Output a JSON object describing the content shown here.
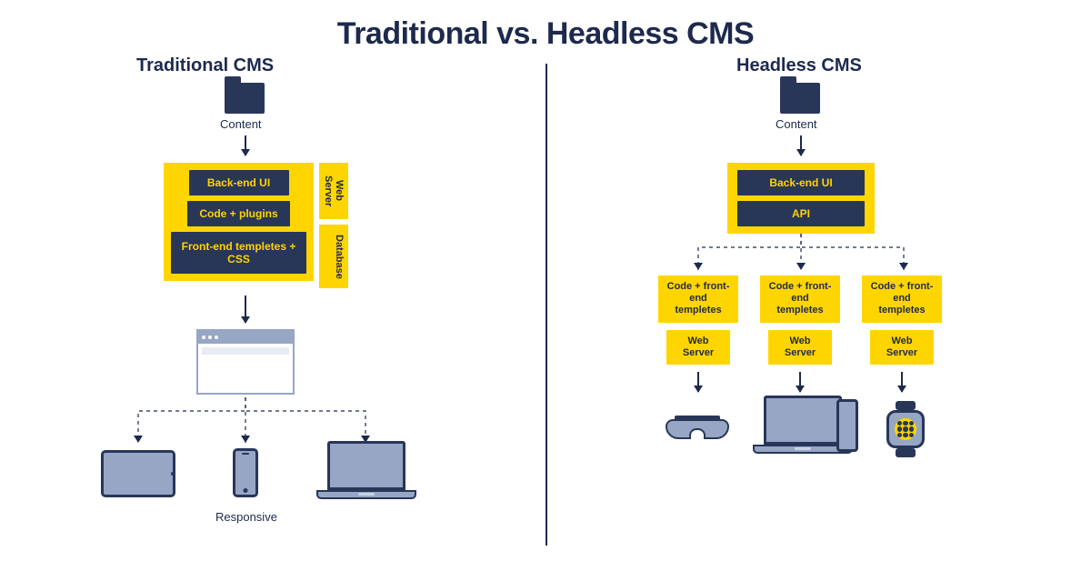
{
  "title": "Traditional vs. Headless CMS",
  "left": {
    "subtitle": "Traditional CMS",
    "content_label": "Content",
    "server": {
      "items": [
        "Back-end UI",
        "Code + plugins",
        "Front-end templetes + CSS"
      ],
      "side_labels": [
        "Web Server",
        "Database"
      ]
    },
    "responsive_label": "Responsive"
  },
  "right": {
    "subtitle": "Headless CMS",
    "content_label": "Content",
    "server": {
      "items": [
        "Back-end UI",
        "API"
      ]
    },
    "channels": [
      {
        "top": "Code + front-end templetes",
        "bottom": "Web Server"
      },
      {
        "top": "Code + front-end templetes",
        "bottom": "Web Server"
      },
      {
        "top": "Code + front-end templetes",
        "bottom": "Web Server"
      }
    ]
  }
}
